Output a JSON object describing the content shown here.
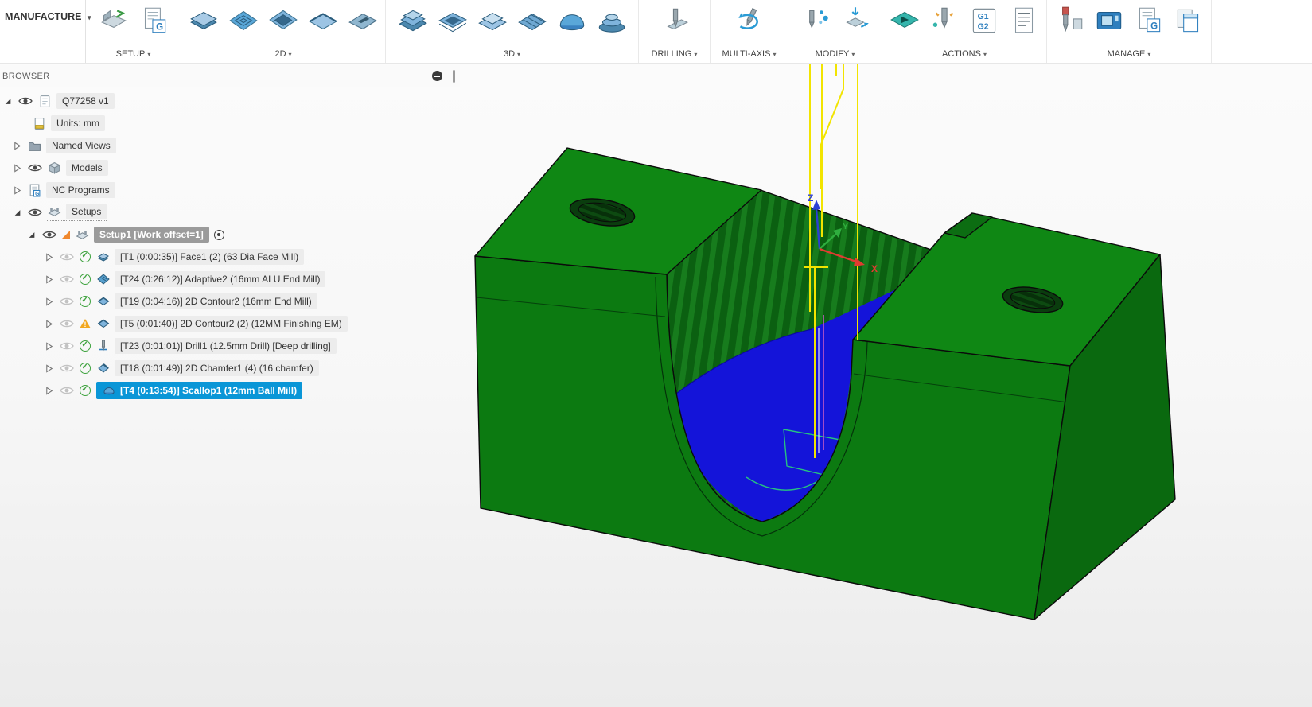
{
  "workspace_tab": {
    "label": "MANUFACTURE"
  },
  "toolbar": {
    "groups": [
      {
        "label": "SETUP",
        "icons": [
          "new-setup-icon",
          "nc-program-icon"
        ]
      },
      {
        "label": "2D",
        "icons": [
          "2d-face-icon",
          "2d-adaptive-icon",
          "2d-pocket-icon",
          "2d-contour-icon",
          "2d-slot-icon"
        ]
      },
      {
        "label": "3D",
        "icons": [
          "3d-adaptive-clearing-icon",
          "3d-pocket-clearing-icon",
          "3d-flat-icon",
          "3d-parallel-icon",
          "3d-scallop-icon",
          "3d-spiral-icon"
        ]
      },
      {
        "label": "DRILLING",
        "icons": [
          "drill-icon"
        ]
      },
      {
        "label": "MULTI-AXIS",
        "icons": [
          "multi-axis-swarf-icon"
        ]
      },
      {
        "label": "MODIFY",
        "icons": [
          "modify-toolpath-icon",
          "transform-toolpath-icon"
        ]
      },
      {
        "label": "ACTIONS",
        "icons": [
          "simulate-icon",
          "generate-toolpath-icon",
          "post-process-icon",
          "setup-sheet-icon"
        ]
      },
      {
        "label": "MANAGE",
        "icons": [
          "tool-library-icon",
          "machine-library-icon",
          "post-library-icon",
          "templates-icon"
        ]
      }
    ],
    "post_icon_lines": [
      "G1",
      "G2"
    ],
    "g_letter": "G"
  },
  "browser": {
    "title": "BROWSER",
    "tree": {
      "root_label": "Q77258 v1",
      "units_label": "Units: mm",
      "named_views_label": "Named Views",
      "models_label": "Models",
      "nc_programs_label": "NC Programs",
      "setups_label": "Setups",
      "setup_label": "Setup1 [Work offset=1]",
      "setup_highlighted": true,
      "operations": [
        {
          "label": "[T1 (0:00:35)] Face1 (2) (63 Dia Face Mill)",
          "status": "ok",
          "icon": "face-mill-icon",
          "selected": false
        },
        {
          "label": "[T24 (0:26:12)] Adaptive2 (16mm ALU End Mill)",
          "status": "ok",
          "icon": "adaptive-icon",
          "selected": false
        },
        {
          "label": "[T19 (0:04:16)] 2D Contour2 (16mm End Mill)",
          "status": "ok",
          "icon": "2d-contour-icon",
          "selected": false
        },
        {
          "label": "[T5 (0:01:40)] 2D Contour2 (2) (12MM Finishing EM)",
          "status": "warning",
          "icon": "2d-contour-icon",
          "selected": false
        },
        {
          "label": "[T23 (0:01:01)] Drill1 (12.5mm Drill) [Deep drilling]",
          "status": "ok",
          "icon": "drill-icon",
          "selected": false
        },
        {
          "label": "[T18 (0:01:49)] 2D Chamfer1 (4) (16 chamfer)",
          "status": "ok",
          "icon": "chamfer-icon",
          "selected": false
        },
        {
          "label": "[T4 (0:13:54)] Scallop1 (12mm Ball Mill)",
          "status": "ok",
          "icon": "scallop-icon",
          "selected": true
        }
      ]
    }
  },
  "viewport": {
    "axis_labels": {
      "x": "X",
      "y": "Y",
      "z": "Z"
    },
    "colors": {
      "part_top": "#0f8714",
      "part_front": "#0c7a11",
      "part_side": "#0a690f",
      "machined_surface": "#1414d9",
      "toolpath": "#f2e400",
      "lead_move": "#c45ac4",
      "axis_x": "#e03c31",
      "axis_y": "#2fae3e",
      "axis_z": "#2b3fd4"
    }
  }
}
